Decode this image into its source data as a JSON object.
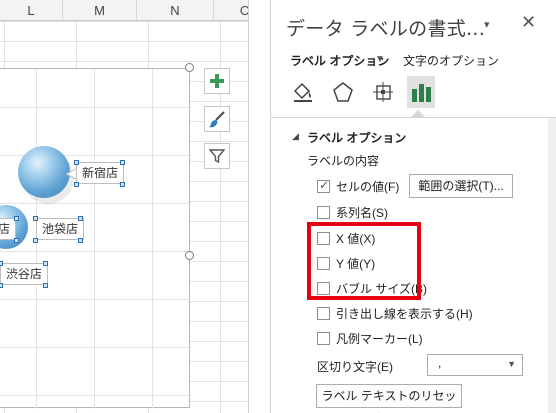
{
  "sheet": {
    "columns": [
      "L",
      "M",
      "N",
      "O"
    ],
    "chart_labels": {
      "shinjuku": "新宿店",
      "ikebukuro": "池袋店",
      "partial": "店",
      "shibuya": "渋谷店"
    },
    "chart_buttons": [
      "plus-icon",
      "brush-icon",
      "filter-icon"
    ]
  },
  "pane": {
    "title": "データ ラベルの書式...",
    "dropdown_glyph": "▾",
    "close_glyph": "✕",
    "tabs": {
      "label_options": "ラベル オプション",
      "caret": "▼",
      "text_options": "文字のオプション"
    },
    "icons": [
      "fill-line-icon",
      "effects-pentagon-icon",
      "size-properties-icon",
      "bar-chart-icon"
    ],
    "section": {
      "caret": "◢",
      "title": "ラベル オプション",
      "contents_label": "ラベルの内容"
    },
    "checkboxes": {
      "cell_value": {
        "label": "セルの値(F)",
        "checked": true
      },
      "series_name": {
        "label": "系列名(S)",
        "checked": false
      },
      "x_value": {
        "label": "X 値(X)",
        "checked": false
      },
      "y_value": {
        "label": "Y 値(Y)",
        "checked": false
      },
      "bubble_size": {
        "label": "バブル サイズ(B)",
        "checked": false
      },
      "leader_lines": {
        "label": "引き出し線を表示する(H)",
        "checked": false
      },
      "legend_key": {
        "label": "凡例マーカー(L)",
        "checked": false
      }
    },
    "range_button": "範囲の選択(T)...",
    "separator": {
      "label": "区切り文字(E)",
      "value": ",",
      "arrow": "▼"
    },
    "reset_button": "ラベル テキストのリセット(R)"
  },
  "colors": {
    "highlight_box": "#e60012",
    "selection": "#2f6fb0",
    "bubble": "#5fa2d4"
  }
}
